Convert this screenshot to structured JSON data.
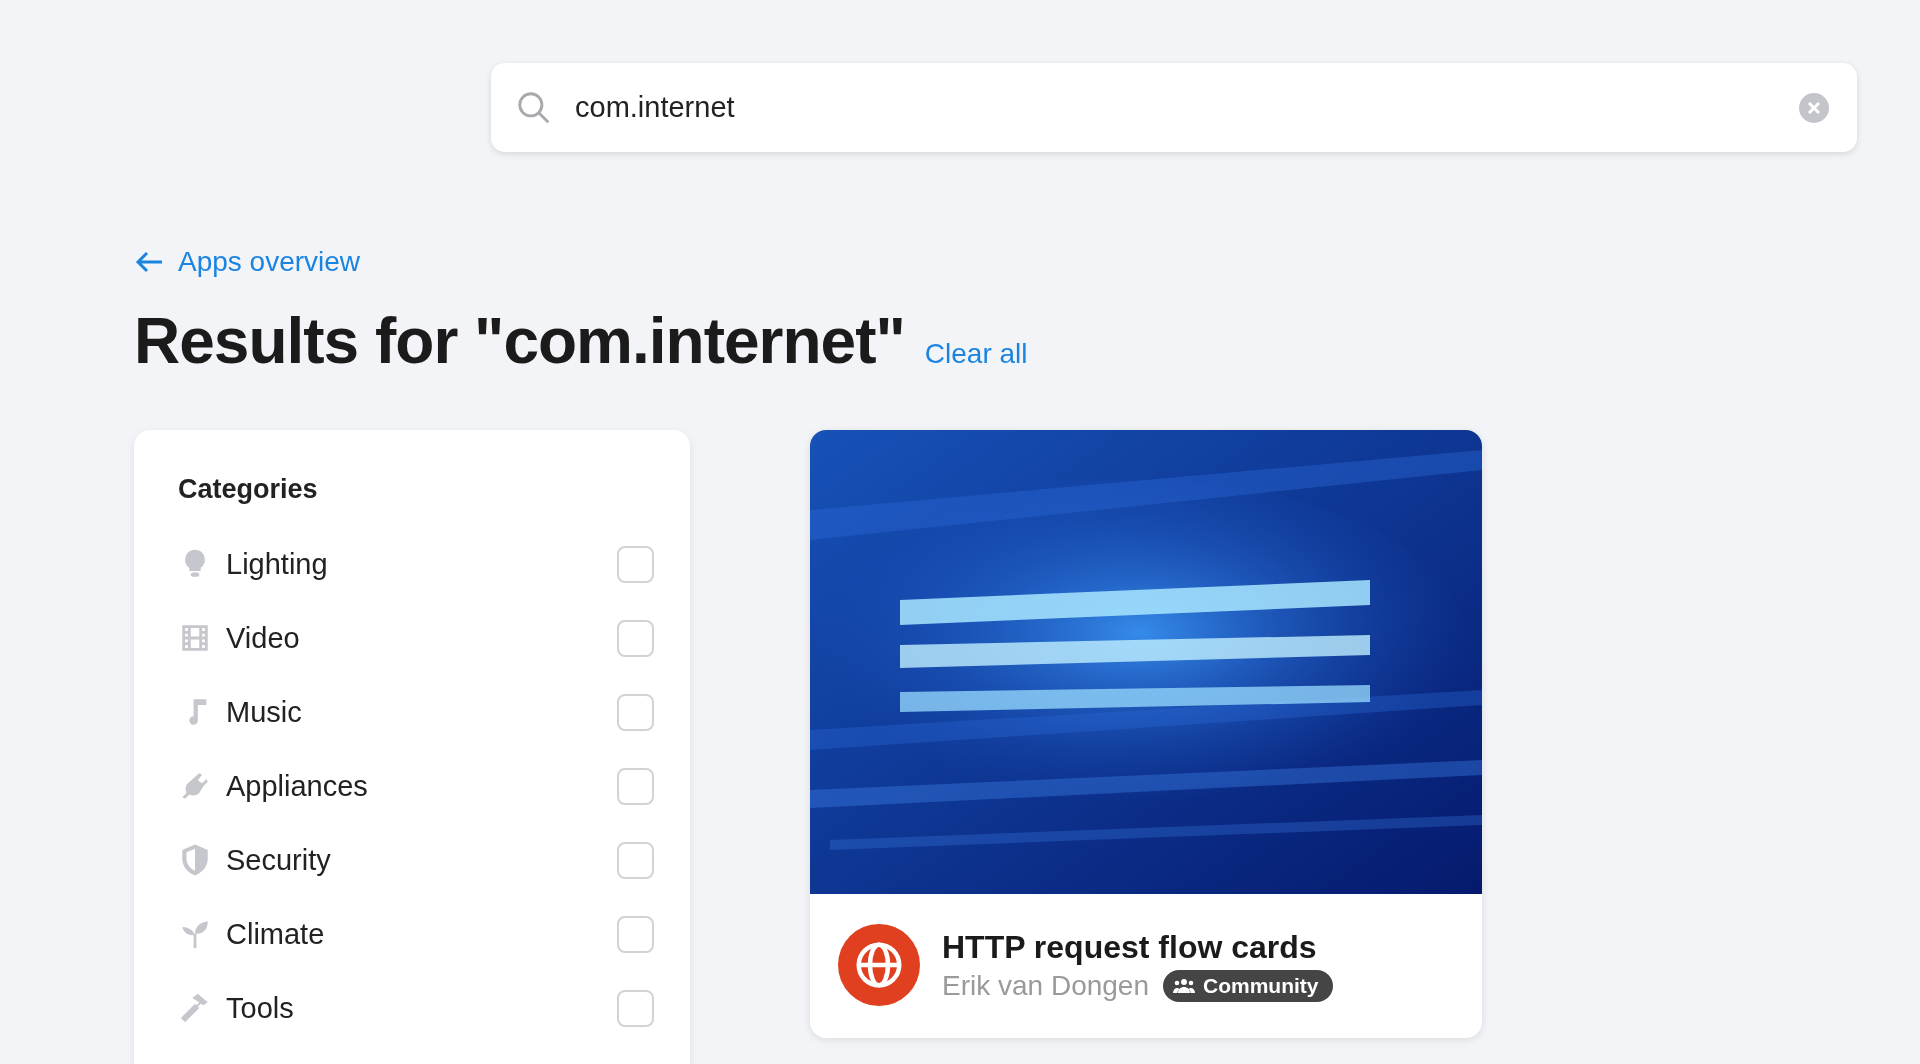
{
  "search": {
    "value": "com.internet"
  },
  "back_link": {
    "label": "Apps overview"
  },
  "heading": {
    "title": "Results for \"com.internet\"",
    "clear_label": "Clear all"
  },
  "categories": {
    "title": "Categories",
    "items": [
      {
        "kind": "lighting",
        "label": "Lighting",
        "checked": false
      },
      {
        "kind": "video",
        "label": "Video",
        "checked": false
      },
      {
        "kind": "music",
        "label": "Music",
        "checked": false
      },
      {
        "kind": "appliances",
        "label": "Appliances",
        "checked": false
      },
      {
        "kind": "security",
        "label": "Security",
        "checked": false
      },
      {
        "kind": "climate",
        "label": "Climate",
        "checked": false
      },
      {
        "kind": "tools",
        "label": "Tools",
        "checked": false
      }
    ]
  },
  "results": [
    {
      "name": "HTTP request flow cards",
      "author": "Erik van Dongen",
      "badge": "Community"
    }
  ]
}
